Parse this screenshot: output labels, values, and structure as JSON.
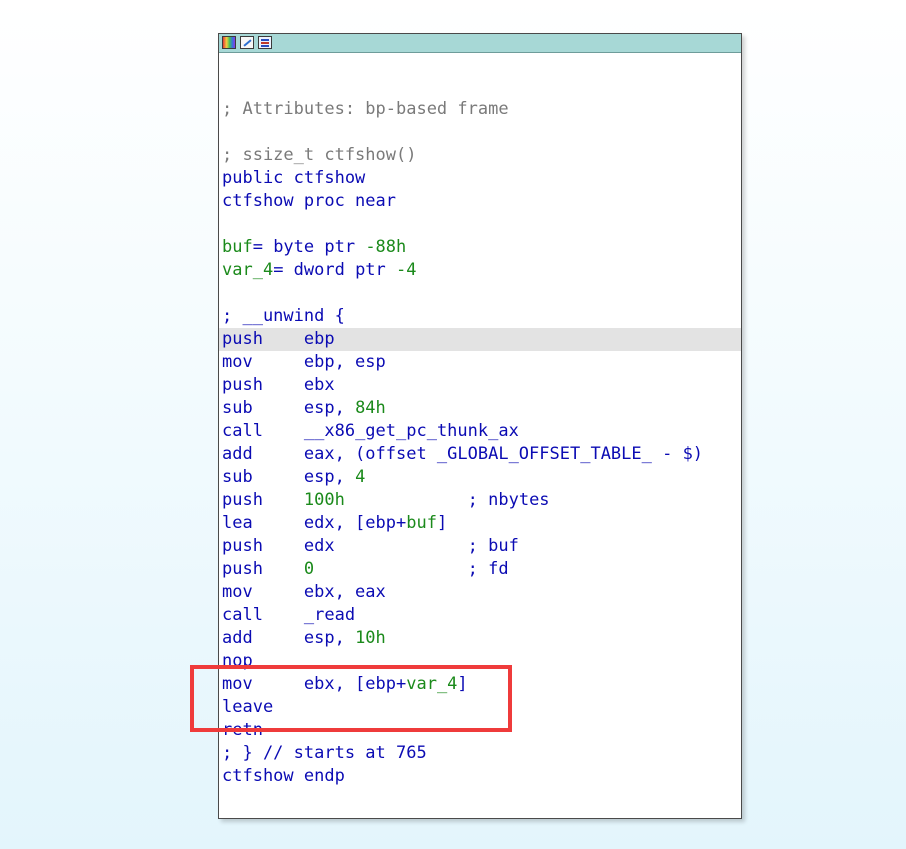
{
  "window": {
    "icons": [
      "graph-overview-icon",
      "edit-icon",
      "text-view-icon"
    ]
  },
  "code_lines": [
    {
      "parts": []
    },
    {
      "parts": []
    },
    {
      "parts": [
        {
          "t": "; Attributes: bp-based frame",
          "c": "c"
        }
      ]
    },
    {
      "parts": []
    },
    {
      "parts": [
        {
          "t": "; ssize_t ctfshow()",
          "c": "c"
        }
      ]
    },
    {
      "parts": [
        {
          "t": "public ctfshow",
          "c": "n"
        }
      ]
    },
    {
      "parts": [
        {
          "t": "ctfshow proc near",
          "c": "n"
        }
      ]
    },
    {
      "parts": []
    },
    {
      "parts": [
        {
          "t": "buf",
          "c": "g"
        },
        {
          "t": "= byte ptr ",
          "c": "n"
        },
        {
          "t": "-88h",
          "c": "g"
        }
      ]
    },
    {
      "parts": [
        {
          "t": "var_4",
          "c": "g"
        },
        {
          "t": "= dword ptr ",
          "c": "n"
        },
        {
          "t": "-4",
          "c": "g"
        }
      ]
    },
    {
      "parts": []
    },
    {
      "parts": [
        {
          "t": "; __unwind {",
          "c": "n"
        }
      ]
    },
    {
      "hl": true,
      "parts": [
        {
          "t": "push    ebp",
          "c": "t"
        }
      ]
    },
    {
      "parts": [
        {
          "t": "mov     ebp, esp",
          "c": "t"
        }
      ]
    },
    {
      "parts": [
        {
          "t": "push    ebx",
          "c": "t"
        }
      ]
    },
    {
      "parts": [
        {
          "t": "sub     esp, ",
          "c": "t"
        },
        {
          "t": "84h",
          "c": "g"
        }
      ]
    },
    {
      "parts": [
        {
          "t": "call    ",
          "c": "t"
        },
        {
          "t": "__x86_get_pc_thunk_ax",
          "c": "n"
        }
      ]
    },
    {
      "parts": [
        {
          "t": "add     eax, (offset _GLOBAL_OFFSET_TABLE_ - $)",
          "c": "t"
        }
      ]
    },
    {
      "parts": [
        {
          "t": "sub     esp, ",
          "c": "t"
        },
        {
          "t": "4",
          "c": "g"
        }
      ]
    },
    {
      "parts": [
        {
          "t": "push    ",
          "c": "t"
        },
        {
          "t": "100h",
          "c": "g"
        },
        {
          "t": "            ; nbytes",
          "c": "n"
        }
      ]
    },
    {
      "parts": [
        {
          "t": "lea     edx, [ebp+",
          "c": "t"
        },
        {
          "t": "buf",
          "c": "g"
        },
        {
          "t": "]",
          "c": "t"
        }
      ]
    },
    {
      "parts": [
        {
          "t": "push    edx",
          "c": "t"
        },
        {
          "t": "             ; buf",
          "c": "n"
        }
      ]
    },
    {
      "parts": [
        {
          "t": "push    ",
          "c": "t"
        },
        {
          "t": "0",
          "c": "g"
        },
        {
          "t": "               ; fd",
          "c": "n"
        }
      ]
    },
    {
      "parts": [
        {
          "t": "mov     ebx, eax",
          "c": "t"
        }
      ]
    },
    {
      "parts": [
        {
          "t": "call    ",
          "c": "t"
        },
        {
          "t": "_read",
          "c": "n"
        }
      ]
    },
    {
      "parts": [
        {
          "t": "add     esp, ",
          "c": "t"
        },
        {
          "t": "10h",
          "c": "g"
        }
      ]
    },
    {
      "parts": [
        {
          "t": "nop",
          "c": "t"
        }
      ]
    },
    {
      "parts": [
        {
          "t": "mov     ebx, [ebp+",
          "c": "t"
        },
        {
          "t": "var_4",
          "c": "g"
        },
        {
          "t": "]",
          "c": "t"
        }
      ]
    },
    {
      "parts": [
        {
          "t": "leave",
          "c": "t"
        }
      ]
    },
    {
      "parts": [
        {
          "t": "retn",
          "c": "t"
        }
      ]
    },
    {
      "parts": [
        {
          "t": "; } // starts at 765",
          "c": "n"
        }
      ]
    },
    {
      "parts": [
        {
          "t": "ctfshow endp",
          "c": "n"
        }
      ]
    }
  ],
  "colors": {
    "titlebar": "#a7d8d6",
    "highlight_box": "#ef3b3b",
    "mnemonic": "#0b0bb3",
    "literal": "#1b8a1b",
    "comment": "#7a7a7a"
  }
}
